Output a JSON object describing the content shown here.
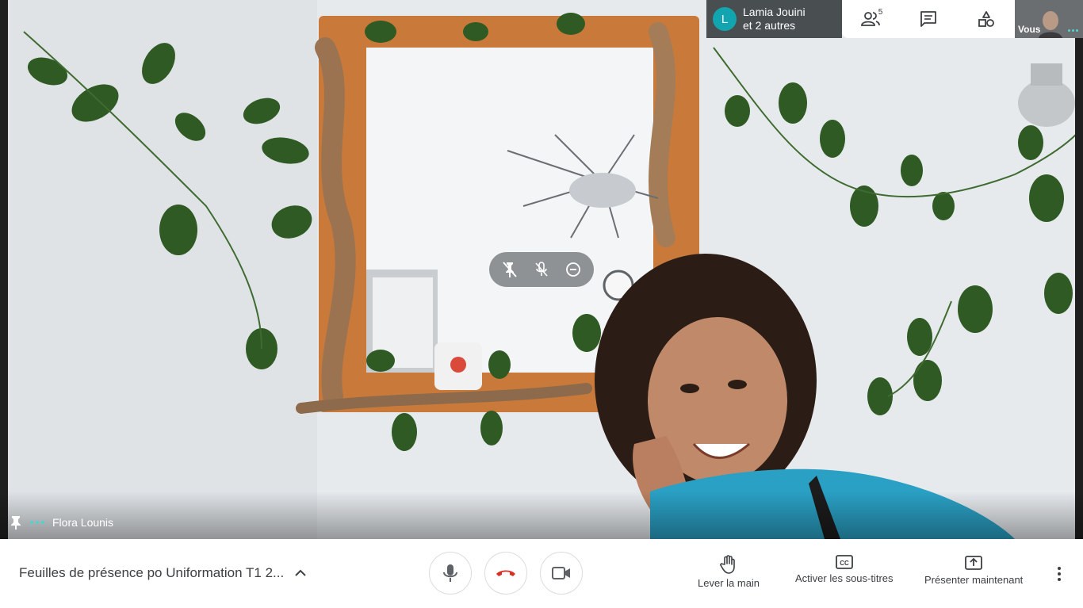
{
  "stage": {
    "participant_name": "Flora Lounis"
  },
  "header": {
    "participants_avatar_letter": "L",
    "participants_line1": "Lamia Jouini",
    "participants_line2": "et 2 autres",
    "participants_count": "5",
    "self_label": "Vous"
  },
  "bottom_bar": {
    "meeting_title": "Feuilles de présence po Uniformation T1 2...",
    "raise_hand_label": "Lever la main",
    "captions_label": "Activer les sous-titres",
    "present_label": "Présenter maintenant"
  },
  "colors": {
    "accent_teal": "#12a4af",
    "hangup_red": "#d93025",
    "text_primary": "#3c4043"
  },
  "icons": [
    "pin-icon",
    "mute-pin-icon",
    "mic-off-icon",
    "remove-icon",
    "people-icon",
    "chat-icon",
    "activities-icon",
    "mic-icon",
    "hangup-icon",
    "camera-icon",
    "hand-icon",
    "captions-icon",
    "present-icon",
    "more-vert-icon",
    "chevron-up-icon"
  ]
}
